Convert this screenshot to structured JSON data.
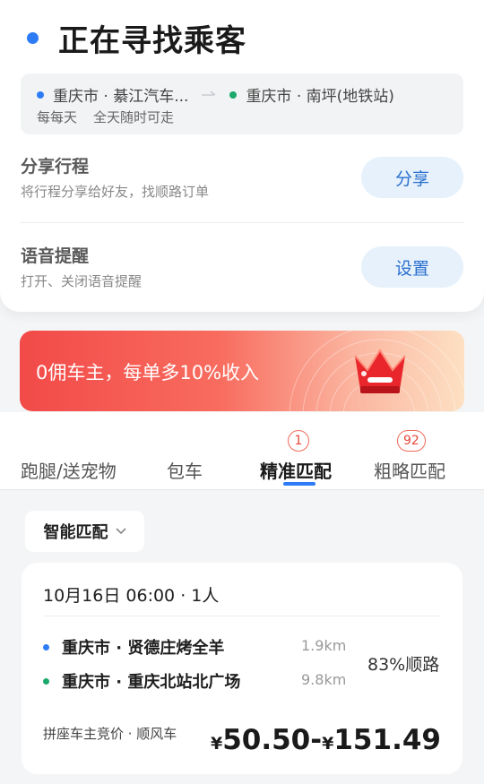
{
  "status": {
    "title": "正在寻找乘客"
  },
  "route": {
    "from": "重庆市 · 綦江汽车...",
    "to": "重庆市 · 南坪(地铁站)",
    "frequency": "每每天",
    "time": "全天随时可走"
  },
  "share": {
    "title": "分享行程",
    "desc": "将行程分享给好友，找顺路订单",
    "button": "分享"
  },
  "voice": {
    "title": "语音提醒",
    "desc": "打开、关闭语音提醒",
    "button": "设置"
  },
  "banner": {
    "text": "0佣车主，每单多10%收入"
  },
  "tabs": [
    {
      "label": "跑腿/送宠物"
    },
    {
      "label": "包车"
    },
    {
      "label": "精准匹配",
      "badge": "1"
    },
    {
      "label": "粗略匹配",
      "badge": "92"
    }
  ],
  "filter": {
    "label": "智能匹配"
  },
  "order": {
    "datetime": "10月16日 06:00 · 1人",
    "pickup": {
      "name": "重庆市 · 贤德庄烤全羊",
      "distance": "1.9km"
    },
    "dropoff": {
      "name": "重庆市 · 重庆北站北广场",
      "distance": "9.8km"
    },
    "match": "83%顺路",
    "footnote": "拼座车主竞价 · 顺风车",
    "currency": "¥",
    "price_low": "50.50",
    "price_sep": "-",
    "price_high": "151.49"
  },
  "colors": {
    "accent": "#2d7cf6",
    "green": "#1aa86b",
    "badge": "#e6483a"
  }
}
